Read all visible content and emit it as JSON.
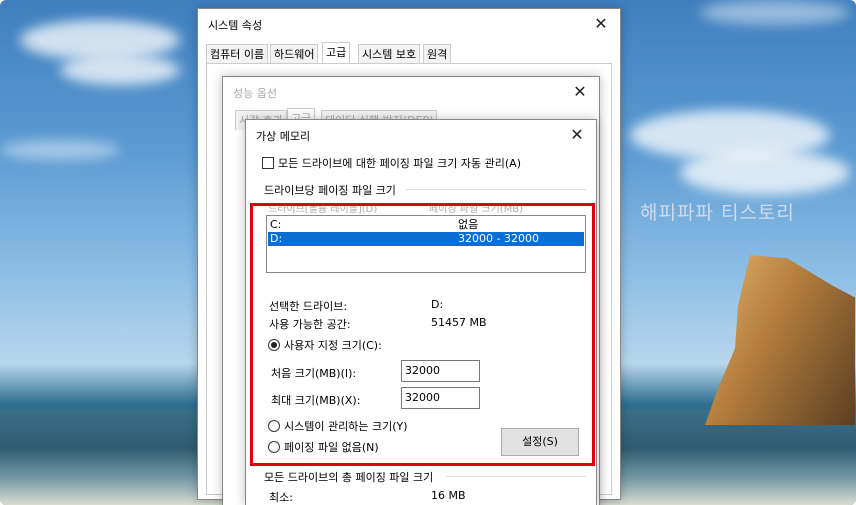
{
  "watermark": "해피파파 티스토리",
  "system_props": {
    "title": "시스템 속성",
    "tabs": [
      "컴퓨터 이름",
      "하드웨어",
      "고급",
      "시스템 보호",
      "원격"
    ],
    "active_tab": "고급"
  },
  "perf_options": {
    "title": "성능 옵션",
    "tabs": [
      "시각 효과",
      "고급",
      "데이터 실행 방지(DEP)"
    ]
  },
  "virtual_memory": {
    "title": "가상 메모리",
    "auto_manage_label": "모든 드라이브에 대한 페이징 파일 크기 자동 관리(A)",
    "auto_manage_checked": false,
    "per_drive_group": "드라이브당 페이징 파일 크기",
    "col_drive": "드라이브[볼륨 레이블](D)",
    "col_size": "페이징 파일 크기(MB)",
    "drives": [
      {
        "drive": "C:",
        "size": "없음",
        "selected": false
      },
      {
        "drive": "D:",
        "size": "32000 - 32000",
        "selected": true
      }
    ],
    "selected_drive_label": "선택한 드라이브:",
    "selected_drive_value": "D:",
    "available_label": "사용 가능한 공간:",
    "available_value": "51457 MB",
    "custom_size_label": "사용자 지정 크기(C):",
    "initial_label": "처음 크기(MB)(I):",
    "initial_value": "32000",
    "max_label": "최대 크기(MB)(X):",
    "max_value": "32000",
    "system_managed_label": "시스템이 관리하는 크기(Y)",
    "no_paging_label": "페이징 파일 없음(N)",
    "set_button": "설정(S)",
    "total_group": "모든 드라이브의 총 페이징 파일 크기",
    "min_label": "최소:",
    "min_value": "16 MB"
  }
}
